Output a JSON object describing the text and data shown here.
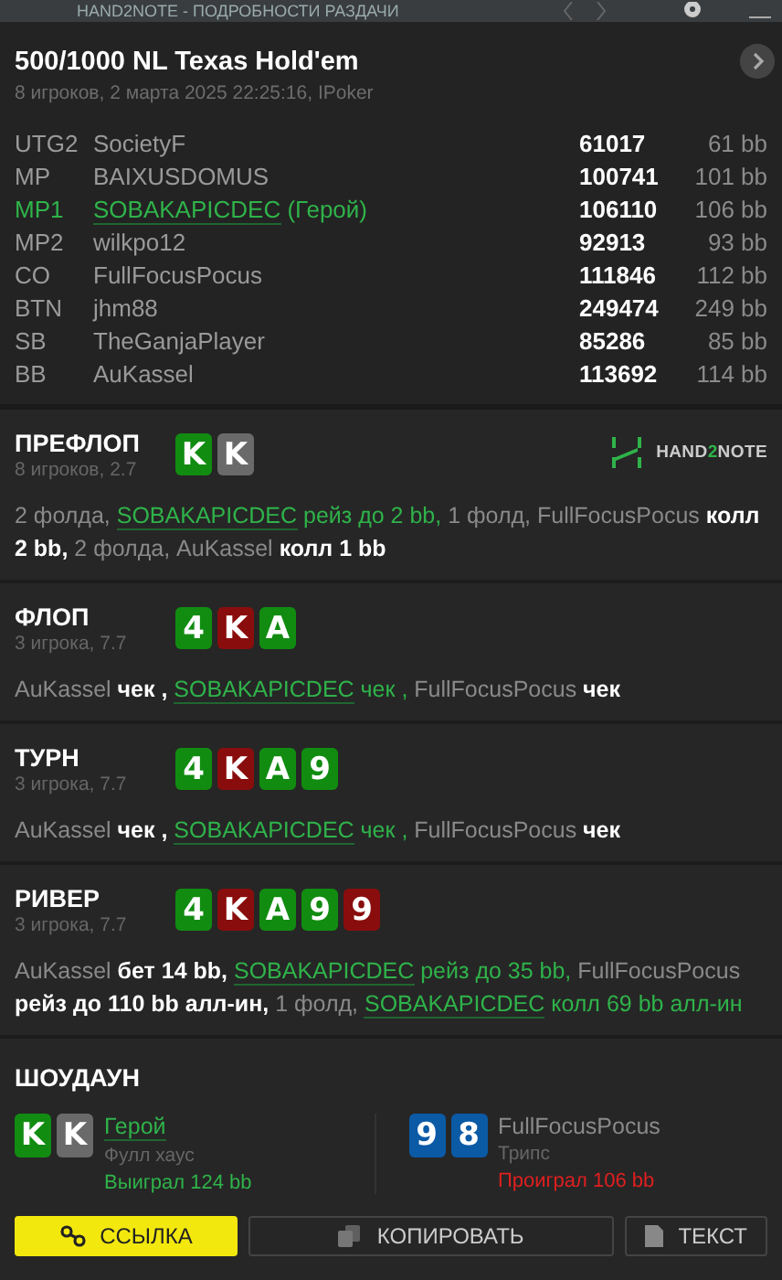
{
  "window": {
    "title": "HAND2NOTE - ПОДРОБНОСТИ РАЗДАЧИ"
  },
  "header": {
    "title": "500/1000 NL Texas Hold'em",
    "subtitle": "8 игроков, 2 марта 2025 22:25:16, IPoker"
  },
  "players": [
    {
      "position": "UTG2",
      "name": "SocietyF",
      "chips": "61017",
      "bb": "61 bb",
      "hero": false
    },
    {
      "position": "MP",
      "name": "BAIXUSDOMUS",
      "chips": "100741",
      "bb": "101 bb",
      "hero": false
    },
    {
      "position": "MP1",
      "name": "SOBAKAPICDEC",
      "suffix": "(Герой)",
      "chips": "106110",
      "bb": "106 bb",
      "hero": true
    },
    {
      "position": "MP2",
      "name": "wilkpo12",
      "chips": "92913",
      "bb": "93 bb",
      "hero": false
    },
    {
      "position": "CO",
      "name": "FullFocusPocus",
      "chips": "111846",
      "bb": "112 bb",
      "hero": false
    },
    {
      "position": "BTN",
      "name": "jhm88",
      "chips": "249474",
      "bb": "249 bb",
      "hero": false
    },
    {
      "position": "SB",
      "name": "TheGanjaPlayer",
      "chips": "85286",
      "bb": "85 bb",
      "hero": false
    },
    {
      "position": "BB",
      "name": "AuKassel",
      "chips": "113692",
      "bb": "114 bb",
      "hero": false
    }
  ],
  "logo": [
    {
      "text": "HAND",
      "accent": false
    },
    {
      "text": "2",
      "accent": true
    },
    {
      "text": "NOTE",
      "accent": false
    }
  ],
  "streets": [
    {
      "name": "ПРЕФЛОП",
      "info": "8 игроков, 2.7",
      "cards": [
        {
          "rank": "K",
          "color": "#118c11"
        },
        {
          "rank": "K",
          "color": "#6a6a6a"
        }
      ],
      "logo": true,
      "actions": [
        {
          "text": "2 фолда, ",
          "kind": "info"
        },
        {
          "text": "SOBAKAPICDEC",
          "kind": "hero"
        },
        {
          "text": " рейз до 2 bb, ",
          "kind": "hero_act"
        },
        {
          "text": "1 фолд, ",
          "kind": "info"
        },
        {
          "text": "FullFocusPocus ",
          "kind": "name"
        },
        {
          "text": "колл 2 bb, ",
          "kind": "act"
        },
        {
          "text": "2 фолда, ",
          "kind": "info"
        },
        {
          "text": "AuKassel ",
          "kind": "name"
        },
        {
          "text": "колл 1 bb",
          "kind": "act"
        }
      ]
    },
    {
      "name": "ФЛОП",
      "info": "3 игрока, 7.7",
      "cards": [
        {
          "rank": "4",
          "color": "#118c11"
        },
        {
          "rank": "K",
          "color": "#8a0d0d"
        },
        {
          "rank": "A",
          "color": "#118c11"
        }
      ],
      "logo": false,
      "actions": [
        {
          "text": "AuKassel ",
          "kind": "name"
        },
        {
          "text": "чек , ",
          "kind": "act"
        },
        {
          "text": "SOBAKAPICDEC",
          "kind": "hero"
        },
        {
          "text": " чек , ",
          "kind": "hero_act"
        },
        {
          "text": "FullFocusPocus ",
          "kind": "name"
        },
        {
          "text": "чек",
          "kind": "act"
        }
      ]
    },
    {
      "name": "ТУРН",
      "info": "3 игрока, 7.7",
      "cards": [
        {
          "rank": "4",
          "color": "#118c11"
        },
        {
          "rank": "K",
          "color": "#8a0d0d"
        },
        {
          "rank": "A",
          "color": "#118c11"
        },
        {
          "rank": "9",
          "color": "#118c11"
        }
      ],
      "logo": false,
      "actions": [
        {
          "text": "AuKassel ",
          "kind": "name"
        },
        {
          "text": "чек , ",
          "kind": "act"
        },
        {
          "text": "SOBAKAPICDEC",
          "kind": "hero"
        },
        {
          "text": " чек , ",
          "kind": "hero_act"
        },
        {
          "text": "FullFocusPocus ",
          "kind": "name"
        },
        {
          "text": "чек",
          "kind": "act"
        }
      ]
    },
    {
      "name": "РИВЕР",
      "info": "3 игрока, 7.7",
      "cards": [
        {
          "rank": "4",
          "color": "#118c11"
        },
        {
          "rank": "K",
          "color": "#8a0d0d"
        },
        {
          "rank": "A",
          "color": "#118c11"
        },
        {
          "rank": "9",
          "color": "#118c11"
        },
        {
          "rank": "9",
          "color": "#8a0d0d"
        }
      ],
      "logo": false,
      "actions": [
        {
          "text": "AuKassel ",
          "kind": "name"
        },
        {
          "text": "бет 14 bb, ",
          "kind": "act"
        },
        {
          "text": "SOBAKAPICDEC",
          "kind": "hero"
        },
        {
          "text": " рейз до 35 bb, ",
          "kind": "hero_act"
        },
        {
          "text": "FullFocusPocus ",
          "kind": "name"
        },
        {
          "text": "рейз до 110 bb алл-ин, ",
          "kind": "act"
        },
        {
          "text": "1 фолд, ",
          "kind": "info"
        },
        {
          "text": "SOBAKAPICDEC",
          "kind": "hero"
        },
        {
          "text": " колл 69 bb алл-ин",
          "kind": "hero_act"
        }
      ]
    }
  ],
  "showdown": {
    "title": "ШОУДАУН",
    "players": [
      {
        "name": "Герой",
        "hero": true,
        "hand": "Фулл хаус",
        "result": "Выиграл 124 bb",
        "won": true,
        "cards": [
          {
            "rank": "K",
            "color": "#118c11"
          },
          {
            "rank": "K",
            "color": "#6a6a6a"
          }
        ]
      },
      {
        "name": "FullFocusPocus",
        "hero": false,
        "hand": "Трипс",
        "result": "Проиграл 106 bb",
        "won": false,
        "cards": [
          {
            "rank": "9",
            "color": "#0b5aa6"
          },
          {
            "rank": "8",
            "color": "#0b5aa6"
          }
        ]
      }
    ]
  },
  "buttons": [
    {
      "label": "ССЫЛКА",
      "kind": "link",
      "primary": true
    },
    {
      "label": "КОПИРОВАТЬ",
      "kind": "copy",
      "primary": false
    },
    {
      "label": "ТЕКСТ",
      "kind": "text",
      "primary": false
    }
  ]
}
